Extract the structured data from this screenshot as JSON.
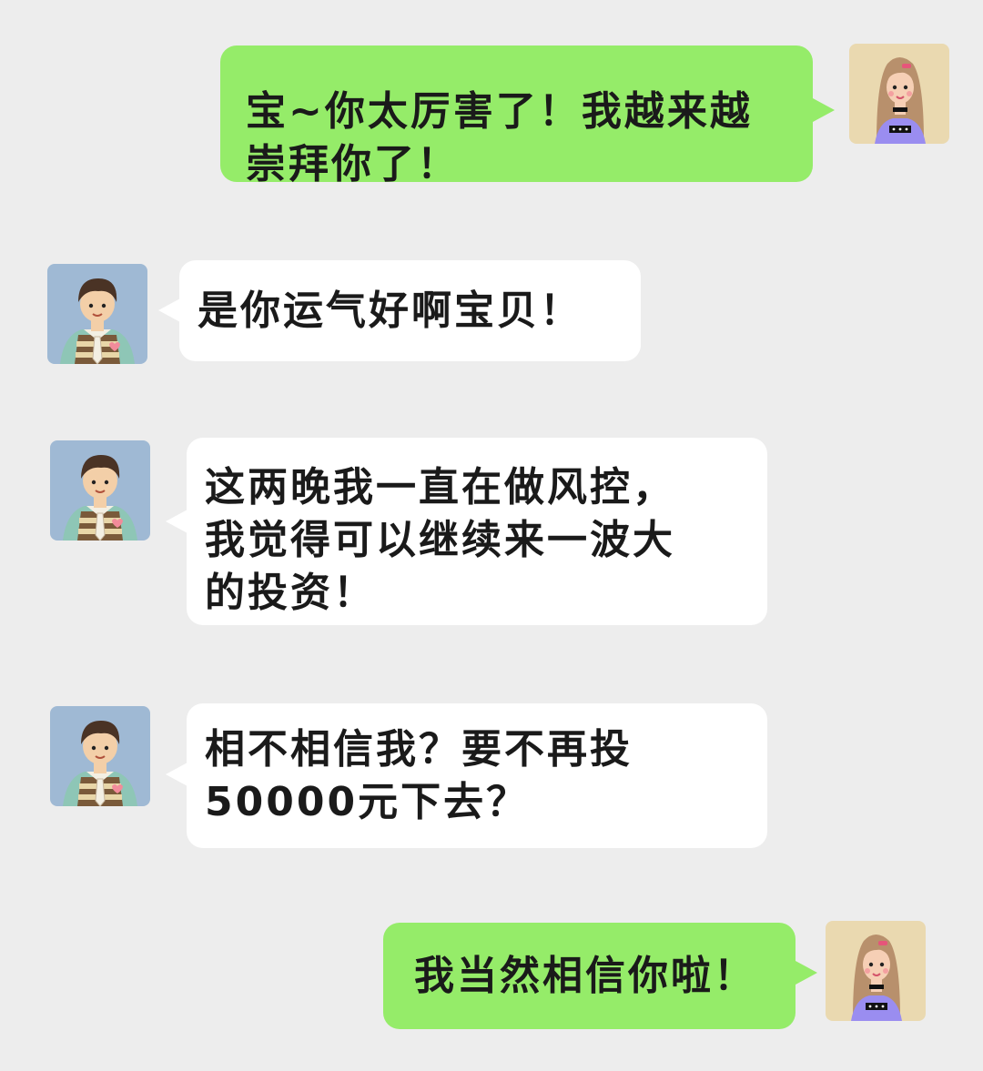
{
  "colors": {
    "background": "#ededed",
    "sent_bubble": "#95ec69",
    "received_bubble": "#ffffff",
    "text": "#1a1a1a"
  },
  "messages": [
    {
      "sender": "girl",
      "direction": "sent",
      "avatar_icon": "girl-avatar-icon",
      "text": "宝~你太厉害了！我越来越\n崇拜你了！"
    },
    {
      "sender": "boy",
      "direction": "received",
      "avatar_icon": "boy-avatar-icon",
      "text": "是你运气好啊宝贝！"
    },
    {
      "sender": "boy",
      "direction": "received",
      "avatar_icon": "boy-avatar-icon",
      "text": "这两晚我一直在做风控，\n我觉得可以继续来一波大\n的投资！"
    },
    {
      "sender": "boy",
      "direction": "received",
      "avatar_icon": "boy-avatar-icon",
      "text": "相不相信我？要不再投\n50000元下去？"
    },
    {
      "sender": "girl",
      "direction": "sent",
      "avatar_icon": "girl-avatar-icon",
      "text": "我当然相信你啦！"
    }
  ]
}
